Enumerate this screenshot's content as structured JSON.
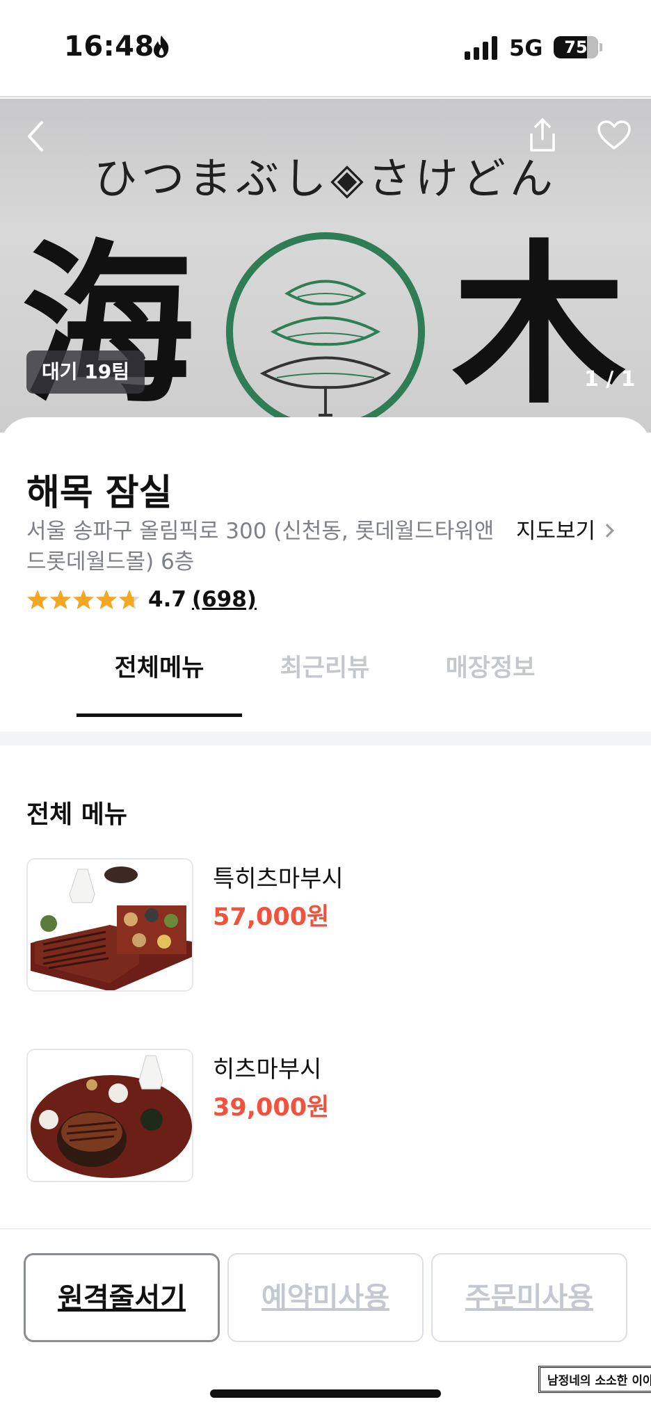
{
  "status_bar": {
    "time": "16:48",
    "network": "5G",
    "battery": "75",
    "battery_level": 0.75
  },
  "hero": {
    "sign_subtitle": "ひつまぶし◈さけどん",
    "kanji_left": "海",
    "kanji_right": "木",
    "wait_badge": "대기 19팀",
    "image_counter": "1 / 1"
  },
  "shop": {
    "name": "해목 잠실",
    "address": "서울 송파구 올림픽로 300 (신천동, 롯데월드타워앤드롯데월드몰) 6층",
    "map_link": "지도보기",
    "rating": "4.7",
    "rating_value": 4.7,
    "review_count": "(698)"
  },
  "tabs": [
    {
      "label": "전체메뉴",
      "active": true
    },
    {
      "label": "최근리뷰",
      "active": false
    },
    {
      "label": "매장정보",
      "active": false
    }
  ],
  "menu": {
    "section_title": "전체 메뉴",
    "items": [
      {
        "name": "특히츠마부시",
        "price": "57,000원"
      },
      {
        "name": "히츠마부시",
        "price": "39,000원"
      }
    ]
  },
  "actions": [
    {
      "label": "원격줄서기",
      "enabled": true
    },
    {
      "label": "예약미사용",
      "enabled": false
    },
    {
      "label": "주문미사용",
      "enabled": false
    }
  ],
  "watermark": "남정네의 소소한 이야기",
  "colors": {
    "price": "#f0523d",
    "star": "#f5a623",
    "crest_green": "#2e7d55",
    "tab_inactive": "#c4c7cc"
  },
  "icons": [
    "back-arrow-icon",
    "share-icon",
    "heart-icon",
    "chevron-right-icon",
    "star-icon",
    "flame-icon"
  ]
}
